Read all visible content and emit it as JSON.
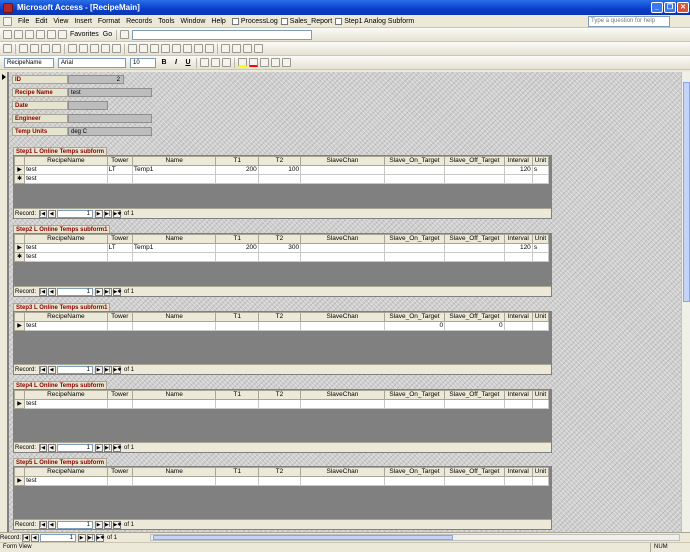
{
  "window": {
    "title": "Microsoft Access - [RecipeMain]"
  },
  "menu": {
    "items": [
      "File",
      "Edit",
      "View",
      "Insert",
      "Format",
      "Records",
      "Tools",
      "Window",
      "Help"
    ],
    "shortcuts": [
      "ProcessLog",
      "Sales_Report",
      "Step1 Analog Subform"
    ],
    "help_placeholder": "Type a question for help"
  },
  "toolbar1": {
    "favorites_label": "Favorites",
    "go_label": "Go"
  },
  "toolbar3": {
    "object_combo": "RecipeName",
    "font_combo": "Arial",
    "size_combo": "10",
    "bold": "B",
    "italic": "I",
    "underline": "U"
  },
  "form": {
    "fields": [
      {
        "label": "ID",
        "value": "2"
      },
      {
        "label": "Recipe Name",
        "value": "test"
      },
      {
        "label": "Date",
        "value": ""
      },
      {
        "label": "Engineer",
        "value": ""
      },
      {
        "label": "Temp Units",
        "value": "deg C"
      }
    ]
  },
  "columns": [
    "RecipeName",
    "Tower",
    "Name",
    "T1",
    "T2",
    "SlaveChan",
    "Slave_On_Target",
    "Slave_Off_Target",
    "Interval",
    "Unit"
  ],
  "subforms": [
    {
      "title": "Step1 L Online Temps subform",
      "rows": [
        [
          "test",
          "LT",
          "Temp1",
          "200",
          "100",
          "",
          "",
          "",
          "120",
          "s"
        ],
        [
          "test",
          "",
          "",
          "",
          "",
          "",
          "",
          "",
          "",
          ""
        ]
      ],
      "selectors": [
        "▶",
        "✱"
      ],
      "nav": {
        "record_label": "Record:",
        "current": "1",
        "of": "of 1"
      }
    },
    {
      "title": "Step2 L Online Temps subform1",
      "rows": [
        [
          "test",
          "LT",
          "Temp1",
          "200",
          "300",
          "",
          "",
          "",
          "120",
          "s"
        ],
        [
          "test",
          "",
          "",
          "",
          "",
          "",
          "",
          "",
          "",
          ""
        ]
      ],
      "selectors": [
        "▶",
        "✱"
      ],
      "nav": {
        "record_label": "Record:",
        "current": "1",
        "of": "of 1"
      }
    },
    {
      "title": "Step3 L Online Temps subform1",
      "rows": [
        [
          "test",
          "",
          "",
          "",
          "",
          "",
          "0",
          "0",
          "",
          ""
        ]
      ],
      "selectors": [
        "▶"
      ],
      "nav": {
        "record_label": "Record:",
        "current": "1",
        "of": "of 1"
      }
    },
    {
      "title": "Step4 L Online Temps subform",
      "rows": [
        [
          "test",
          "",
          "",
          "",
          "",
          "",
          "",
          "",
          "",
          ""
        ]
      ],
      "selectors": [
        "▶"
      ],
      "nav": {
        "record_label": "Record:",
        "current": "1",
        "of": "of 1"
      }
    },
    {
      "title": "Step5 L Online Temps subform",
      "rows": [
        [
          "test",
          "",
          "",
          "",
          "",
          "",
          "",
          "",
          "",
          ""
        ]
      ],
      "selectors": [
        "▶"
      ],
      "nav": {
        "record_label": "Record:",
        "current": "1",
        "of": "of 1"
      }
    }
  ],
  "main_nav": {
    "record_label": "Record:",
    "current": "1",
    "of": "of 1"
  },
  "status": {
    "left": "Form View",
    "num": "NUM"
  }
}
